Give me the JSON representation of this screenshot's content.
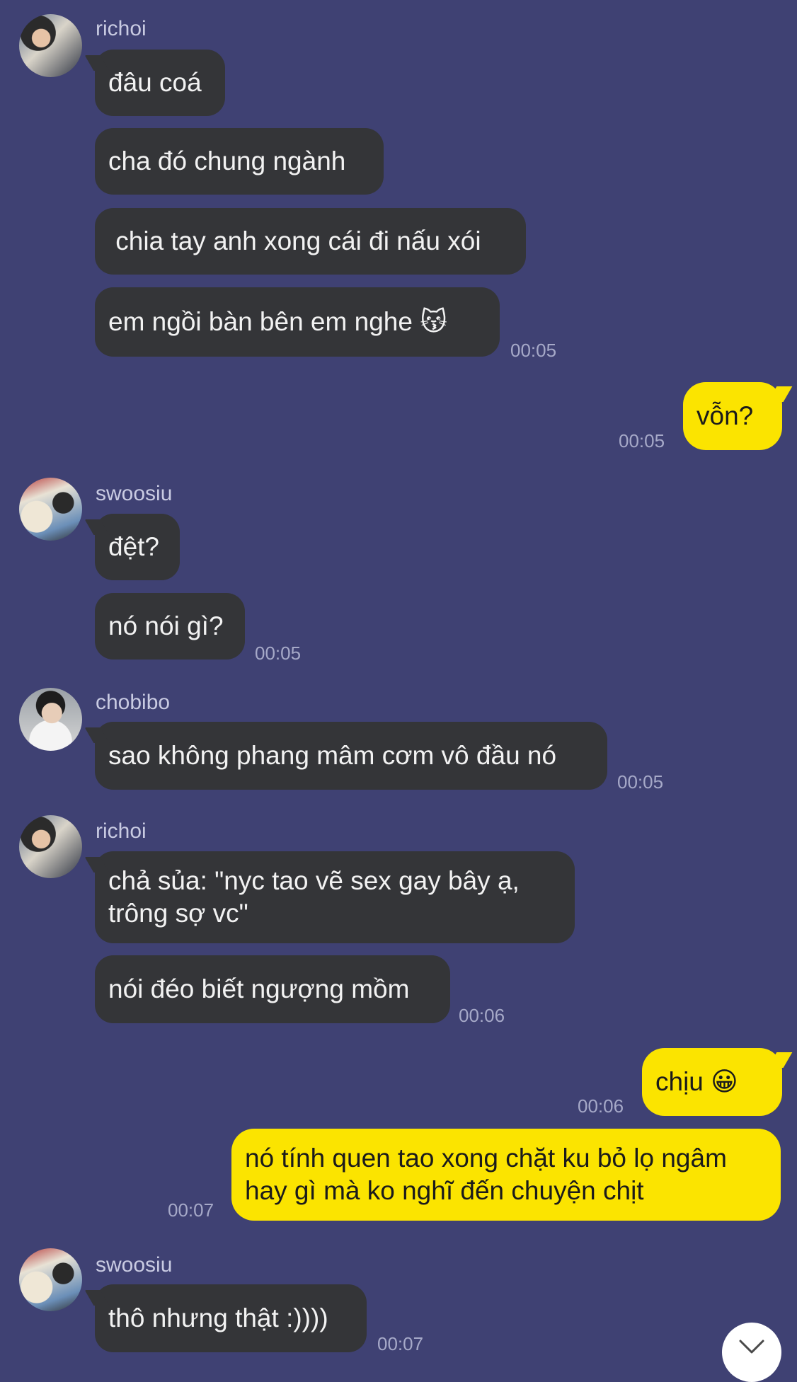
{
  "messages": {
    "g1": {
      "sender": "richoi",
      "b1": "đâu coá",
      "b2": "cha đó chung ngành",
      "b3": " chia tay anh xong cái đi nấu xói",
      "b4": "em ngồi bàn bên em nghe 😽",
      "time": "00:05"
    },
    "o1": {
      "text": "vỗn?",
      "time": "00:05"
    },
    "g2": {
      "sender": "swoosiu",
      "b1": "đệt?",
      "b2": "nó nói gì?",
      "time": "00:05"
    },
    "g3": {
      "sender": "chobibo",
      "b1": "sao không phang mâm cơm vô đầu nó",
      "time": "00:05"
    },
    "g4": {
      "sender": "richoi",
      "b1": "chả sủa: \"nyc tao vẽ sex gay bây ạ, trông sợ vc\"",
      "b2": "nói đéo biết ngượng mồm",
      "time": "00:06"
    },
    "o2": {
      "text": "chịu 😀",
      "time": "00:06"
    },
    "o3": {
      "text": "nó tính quen tao xong chặt ku bỏ lọ ngâm hay gì mà ko nghĩ đến chuyện chịt",
      "time": "00:07"
    },
    "g5": {
      "sender": "swoosiu",
      "b1": "thô nhưng thật :))))",
      "time": "00:07"
    }
  },
  "colors": {
    "background": "#3f4173",
    "incoming_bubble": "#343538",
    "outgoing_bubble": "#fbe400"
  },
  "icons": {
    "scroll_down": "chevron-down-icon"
  }
}
